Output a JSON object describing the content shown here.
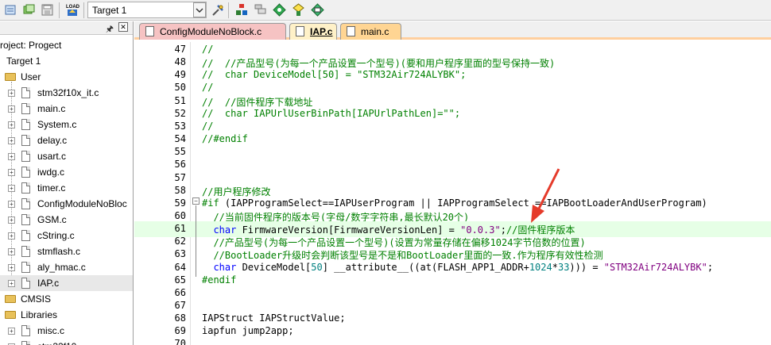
{
  "toolbar": {
    "target_select_value": "Target 1"
  },
  "project_panel": {
    "root_label": "roject: Progect",
    "target_label": "Target 1",
    "groups": [
      {
        "label": "User"
      },
      {
        "label": "CMSIS"
      },
      {
        "label": "Libraries"
      }
    ],
    "user_files": [
      "stm32f10x_it.c",
      "main.c",
      "System.c",
      "delay.c",
      "usart.c",
      "iwdg.c",
      "timer.c",
      "ConfigModuleNoBloc",
      "GSM.c",
      "cString.c",
      "stmflash.c",
      "aly_hmac.c",
      "IAP.c"
    ],
    "library_files": [
      "misc.c",
      "stm32f10..."
    ]
  },
  "tabs": [
    {
      "label": "ConfigModuleNoBlock.c"
    },
    {
      "label": "IAP.c"
    },
    {
      "label": "main.c"
    }
  ],
  "editor": {
    "highlighted_line": "61",
    "lines": [
      {
        "n": "47",
        "text": "//"
      },
      {
        "n": "48",
        "text": "//  //产品型号(为每一个产品设置一个型号)(要和用户程序里面的型号保持一致)"
      },
      {
        "n": "49",
        "text": "//  char DeviceModel[50] = \"STM32Air724ALYBK\";"
      },
      {
        "n": "50",
        "text": "//"
      },
      {
        "n": "51",
        "text": "//  //固件程序下载地址"
      },
      {
        "n": "52",
        "text": "//  char IAPUrlUserBinPath[IAPUrlPathLen]=\"\";"
      },
      {
        "n": "53",
        "text": "//"
      },
      {
        "n": "54",
        "text": "//#endif"
      },
      {
        "n": "55",
        "text": ""
      },
      {
        "n": "56",
        "text": ""
      },
      {
        "n": "57",
        "text": ""
      },
      {
        "n": "58",
        "text": "//用户程序修改"
      },
      {
        "n": "59",
        "text": "#if (IAPProgramSelect==IAPUserProgram || IAPProgramSelect ==IAPBootLoaderAndUserProgram)"
      },
      {
        "n": "60",
        "text": "  //当前固件程序的版本号(字母/数字字符串,最长默认20个)"
      },
      {
        "n": "61",
        "text": "  char FirmwareVersion[FirmwareVersionLen] = \"0.0.3\";//固件程序版本"
      },
      {
        "n": "62",
        "text": "  //产品型号(为每一个产品设置一个型号)(设置为常量存储在偏移1024字节倍数的位置)"
      },
      {
        "n": "63",
        "text": "  //BootLoader升级时会判断该型号是不是和BootLoader里面的一致.作为程序有效性检测"
      },
      {
        "n": "64",
        "text": "  char DeviceModel[50] __attribute__((at(FLASH_APP1_ADDR+1024*33))) = \"STM32Air724ALYBK\";"
      },
      {
        "n": "65",
        "text": "#endif"
      },
      {
        "n": "66",
        "text": ""
      },
      {
        "n": "67",
        "text": ""
      },
      {
        "n": "68",
        "text": "IAPStruct IAPStructValue;"
      },
      {
        "n": "69",
        "text": "iapfun jump2app;"
      },
      {
        "n": "70",
        "text": ""
      }
    ]
  },
  "colors": {
    "comment": "#008000",
    "keyword": "#0000ff",
    "string": "#800080",
    "number": "#008080",
    "highlight_line_bg": "#e6ffe6",
    "annotation_arrow": "#e53a2a"
  },
  "icons": [
    "new-file-icon",
    "open-file-icon",
    "save-file-icon",
    "load-flash-icon",
    "target-options-icon",
    "manage-components-icon",
    "select-packs-icon",
    "pack-installer-icon",
    "batch-build-icon",
    "software-components-icon"
  ]
}
